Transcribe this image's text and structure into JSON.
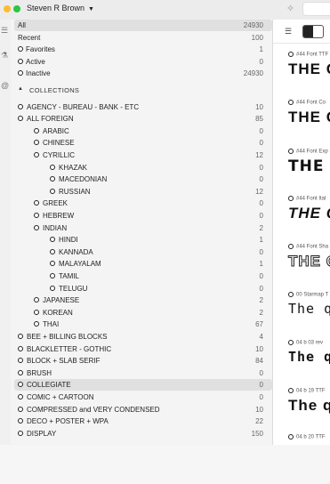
{
  "titlebar": {
    "user": "Steven R Brown"
  },
  "sidebar": {
    "top_items": [
      {
        "label": "All",
        "count": "24930"
      },
      {
        "label": "Recent",
        "count": "100"
      },
      {
        "label": "Favorites",
        "count": "1"
      },
      {
        "label": "Active",
        "count": "0"
      },
      {
        "label": "Inactive",
        "count": "24930"
      }
    ],
    "collections_label": "COLLECTIONS",
    "collections": [
      {
        "label": "AGENCY - BUREAU - BANK - ETC",
        "count": "10",
        "level": 0
      },
      {
        "label": "ALL FOREIGN",
        "count": "85",
        "level": 0
      },
      {
        "label": "ARABIC",
        "count": "0",
        "level": 1
      },
      {
        "label": "CHINESE",
        "count": "0",
        "level": 1
      },
      {
        "label": "CYRILLIC",
        "count": "12",
        "level": 1
      },
      {
        "label": "KHAZAK",
        "count": "0",
        "level": 2
      },
      {
        "label": "MACEDONIAN",
        "count": "0",
        "level": 2
      },
      {
        "label": "RUSSIAN",
        "count": "12",
        "level": 2
      },
      {
        "label": "GREEK",
        "count": "0",
        "level": 1
      },
      {
        "label": "HEBREW",
        "count": "0",
        "level": 1
      },
      {
        "label": "INDIAN",
        "count": "2",
        "level": 1
      },
      {
        "label": "HINDI",
        "count": "1",
        "level": 2
      },
      {
        "label": "KANNADA",
        "count": "0",
        "level": 2
      },
      {
        "label": "MALAYALAM",
        "count": "1",
        "level": 2
      },
      {
        "label": "TAMIL",
        "count": "0",
        "level": 2
      },
      {
        "label": "TELUGU",
        "count": "0",
        "level": 2
      },
      {
        "label": "JAPANESE",
        "count": "2",
        "level": 1
      },
      {
        "label": "KOREAN",
        "count": "2",
        "level": 1
      },
      {
        "label": "THAI",
        "count": "67",
        "level": 1
      },
      {
        "label": "BEE + BILLING BLOCKS",
        "count": "4",
        "level": 0
      },
      {
        "label": "BLACKLETTER - GOTHIC",
        "count": "10",
        "level": 0
      },
      {
        "label": "BLOCK + SLAB SERIF",
        "count": "84",
        "level": 0
      },
      {
        "label": "BRUSH",
        "count": "0",
        "level": 0
      },
      {
        "label": "COLLEGIATE",
        "count": "0",
        "level": 0,
        "selected": true
      },
      {
        "label": "COMIC + CARTOON",
        "count": "0",
        "level": 0
      },
      {
        "label": "COMPRESSED and VERY CONDENSED",
        "count": "10",
        "level": 0
      },
      {
        "label": "DECO + POSTER + WPA",
        "count": "22",
        "level": 0
      },
      {
        "label": "DISPLAY",
        "count": "150",
        "level": 0
      }
    ]
  },
  "preview": {
    "items": [
      {
        "meta": "#44 Font  TTF",
        "sample": "THE Q",
        "style": "s-bold"
      },
      {
        "meta": "#44 Font Co",
        "sample": "THE QU",
        "style": "s-bold"
      },
      {
        "meta": "#44 Font Exp",
        "sample": "THE",
        "style": "s-wide"
      },
      {
        "meta": "#44 Font Ital",
        "sample": "THE Q",
        "style": "s-ital"
      },
      {
        "meta": "#44 Font Sha",
        "sample": "THE Q",
        "style": "s-outline"
      },
      {
        "meta": "00 Starmap T",
        "sample": "The q",
        "style": "s-mono"
      },
      {
        "meta": "04 b 03 rev",
        "sample": "The q",
        "style": "s-pixel"
      },
      {
        "meta": "04 b 19  TTF",
        "sample": "The q",
        "style": "s-bold"
      },
      {
        "meta": "04 b 20  TTF",
        "sample": "",
        "style": "s-bold"
      }
    ]
  }
}
